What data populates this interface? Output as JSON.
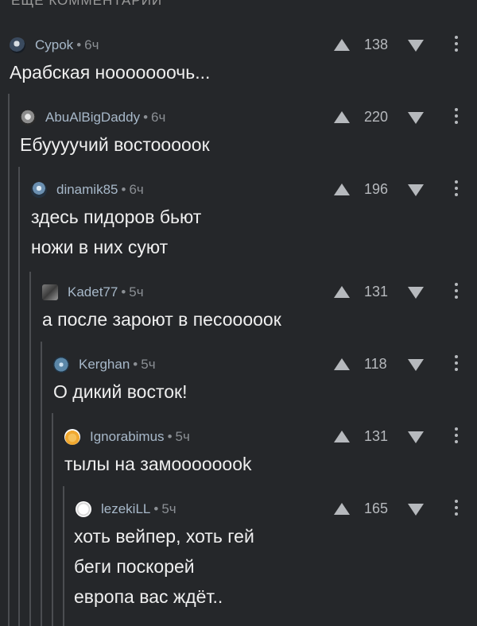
{
  "header_cut": "ЕЩЁ КОММЕНТАРИИ",
  "colors": {
    "background": "#25272a",
    "thread_line": "#4b4d51",
    "author": "#a7b8c9"
  },
  "icons": {
    "upvote": "triangle-up-icon",
    "downvote": "triangle-down-icon",
    "menu": "vertical-dots-icon"
  },
  "comments": [
    {
      "author": "Cypok",
      "sep": "•",
      "time": "6ч",
      "score": "138",
      "text": "Арабская нооооооочь..."
    },
    {
      "author": "AbuAlBigDaddy",
      "sep": "•",
      "time": "6ч",
      "score": "220",
      "text": "Ебуууучий востооооок"
    },
    {
      "author": "dinamik85",
      "sep": "•",
      "time": "6ч",
      "score": "196",
      "text": "здесь пидоров бьют\nножи в них суют"
    },
    {
      "author": "Kadet77",
      "sep": "•",
      "time": "5ч",
      "score": "131",
      "text": "а после зароют в песооооок"
    },
    {
      "author": "Kerghan",
      "sep": "•",
      "time": "5ч",
      "score": "118",
      "text": "О дикий восток!"
    },
    {
      "author": "Ignorabimus",
      "sep": "•",
      "time": "5ч",
      "score": "131",
      "text": "тылы на замоооооook"
    },
    {
      "author": "lezekiLL",
      "sep": "•",
      "time": "5ч",
      "score": "165",
      "text": "хоть вейпер, хоть гей\nбеги поскорей\nевропа вас ждёт.."
    }
  ]
}
